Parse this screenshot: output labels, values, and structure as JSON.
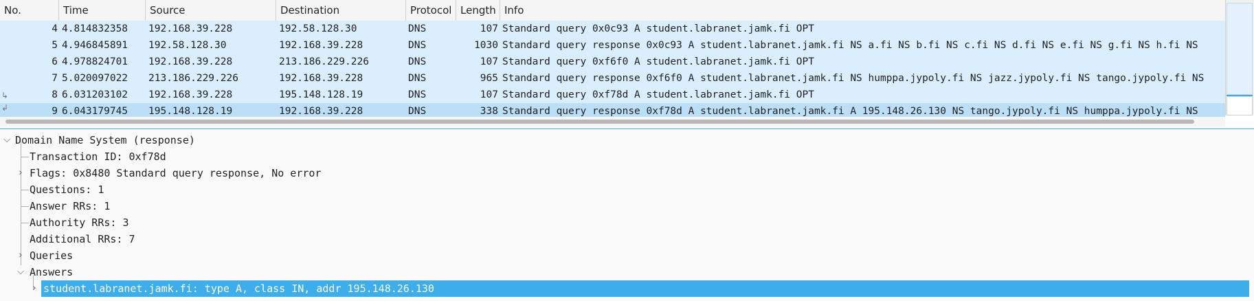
{
  "columns": {
    "no": "No.",
    "time": "Time",
    "source": "Source",
    "destination": "Destination",
    "protocol": "Protocol",
    "length": "Length",
    "info": "Info"
  },
  "packets": [
    {
      "no": "4",
      "time": "4.814832358",
      "source": "192.168.39.228",
      "destination": "192.58.128.30",
      "protocol": "DNS",
      "length": "107",
      "info": "Standard query 0x0c93 A student.labranet.jamk.fi OPT"
    },
    {
      "no": "5",
      "time": "4.946845891",
      "source": "192.58.128.30",
      "destination": "192.168.39.228",
      "protocol": "DNS",
      "length": "1030",
      "info": "Standard query response 0x0c93 A student.labranet.jamk.fi NS a.fi NS b.fi NS c.fi NS d.fi NS e.fi NS g.fi NS h.fi NS"
    },
    {
      "no": "6",
      "time": "4.978824701",
      "source": "192.168.39.228",
      "destination": "213.186.229.226",
      "protocol": "DNS",
      "length": "107",
      "info": "Standard query 0xf6f0 A student.labranet.jamk.fi OPT"
    },
    {
      "no": "7",
      "time": "5.020097022",
      "source": "213.186.229.226",
      "destination": "192.168.39.228",
      "protocol": "DNS",
      "length": "965",
      "info": "Standard query response 0xf6f0 A student.labranet.jamk.fi NS humppa.jypoly.fi NS jazz.jypoly.fi NS tango.jypoly.fi NS"
    },
    {
      "no": "8",
      "time": "6.031203102",
      "source": "192.168.39.228",
      "destination": "195.148.128.19",
      "protocol": "DNS",
      "length": "107",
      "info": "Standard query 0xf78d A student.labranet.jamk.fi OPT"
    },
    {
      "no": "9",
      "time": "6.043179745",
      "source": "195.148.128.19",
      "destination": "192.168.39.228",
      "protocol": "DNS",
      "length": "338",
      "info": "Standard query response 0xf78d A student.labranet.jamk.fi A 195.148.26.130 NS tango.jypoly.fi NS humppa.jypoly.fi NS"
    }
  ],
  "details": {
    "root": "Domain Name System (response)",
    "transaction_id": "Transaction ID: 0xf78d",
    "flags": "Flags: 0x8480 Standard query response, No error",
    "questions": "Questions: 1",
    "answer_rrs": "Answer RRs: 1",
    "authority_rrs": "Authority RRs: 3",
    "additional_rrs": "Additional RRs: 7",
    "queries": "Queries",
    "answers": "Answers",
    "answer_item": "student.labranet.jamk.fi: type A, class IN, addr 195.148.26.130"
  },
  "colors": {
    "row_bg": "#dbeefe",
    "row_selected_bg": "#bcdff8",
    "highlight": "#3daee9"
  },
  "icons": {
    "expand": "chevron-right-icon",
    "collapse": "chevron-down-icon",
    "related": "related-packet-icon"
  }
}
